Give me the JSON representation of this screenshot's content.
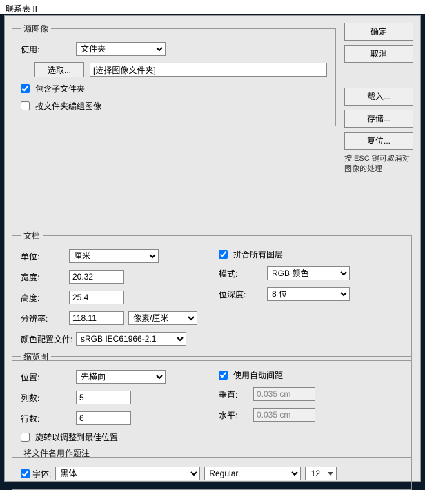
{
  "title": "联系表 II",
  "buttons": {
    "ok": "确定",
    "cancel": "取消",
    "load": "载入...",
    "save": "存储...",
    "reset": "复位..."
  },
  "hint": "按 ESC 键可取消对图像的处理",
  "source": {
    "legend": "源图像",
    "use_label": "使用:",
    "use_value": "文件夹",
    "choose_btn": "选取...",
    "path": "[选择图像文件夹]",
    "include_sub": "包含子文件夹",
    "group_by_folder": "按文件夹编组图像"
  },
  "doc": {
    "legend": "文档",
    "unit_label": "单位:",
    "unit_value": "厘米",
    "width_label": "宽度:",
    "width_value": "20.32",
    "height_label": "高度:",
    "height_value": "25.4",
    "res_label": "分辨率:",
    "res_value": "118.11",
    "res_unit": "像素/厘米",
    "profile_label": "颜色配置文件:",
    "profile_value": "sRGB IEC61966-2.1",
    "flatten": "拼合所有图层",
    "mode_label": "模式:",
    "mode_value": "RGB 颜色",
    "depth_label": "位深度:",
    "depth_value": "8 位"
  },
  "thumb": {
    "legend": "缩览图",
    "place_label": "位置:",
    "place_value": "先横向",
    "cols_label": "列数:",
    "cols_value": "5",
    "rows_label": "行数:",
    "rows_value": "6",
    "rotate": "旋转以调整到最佳位置",
    "auto_spacing": "使用自动间距",
    "v_label": "垂直:",
    "v_value": "0.035 cm",
    "h_label": "水平:",
    "h_value": "0.035 cm"
  },
  "caption": {
    "legend": "将文件名用作题注",
    "font_check": "字体:",
    "font_value": "黑体",
    "style_value": "Regular",
    "size_value": "12"
  }
}
